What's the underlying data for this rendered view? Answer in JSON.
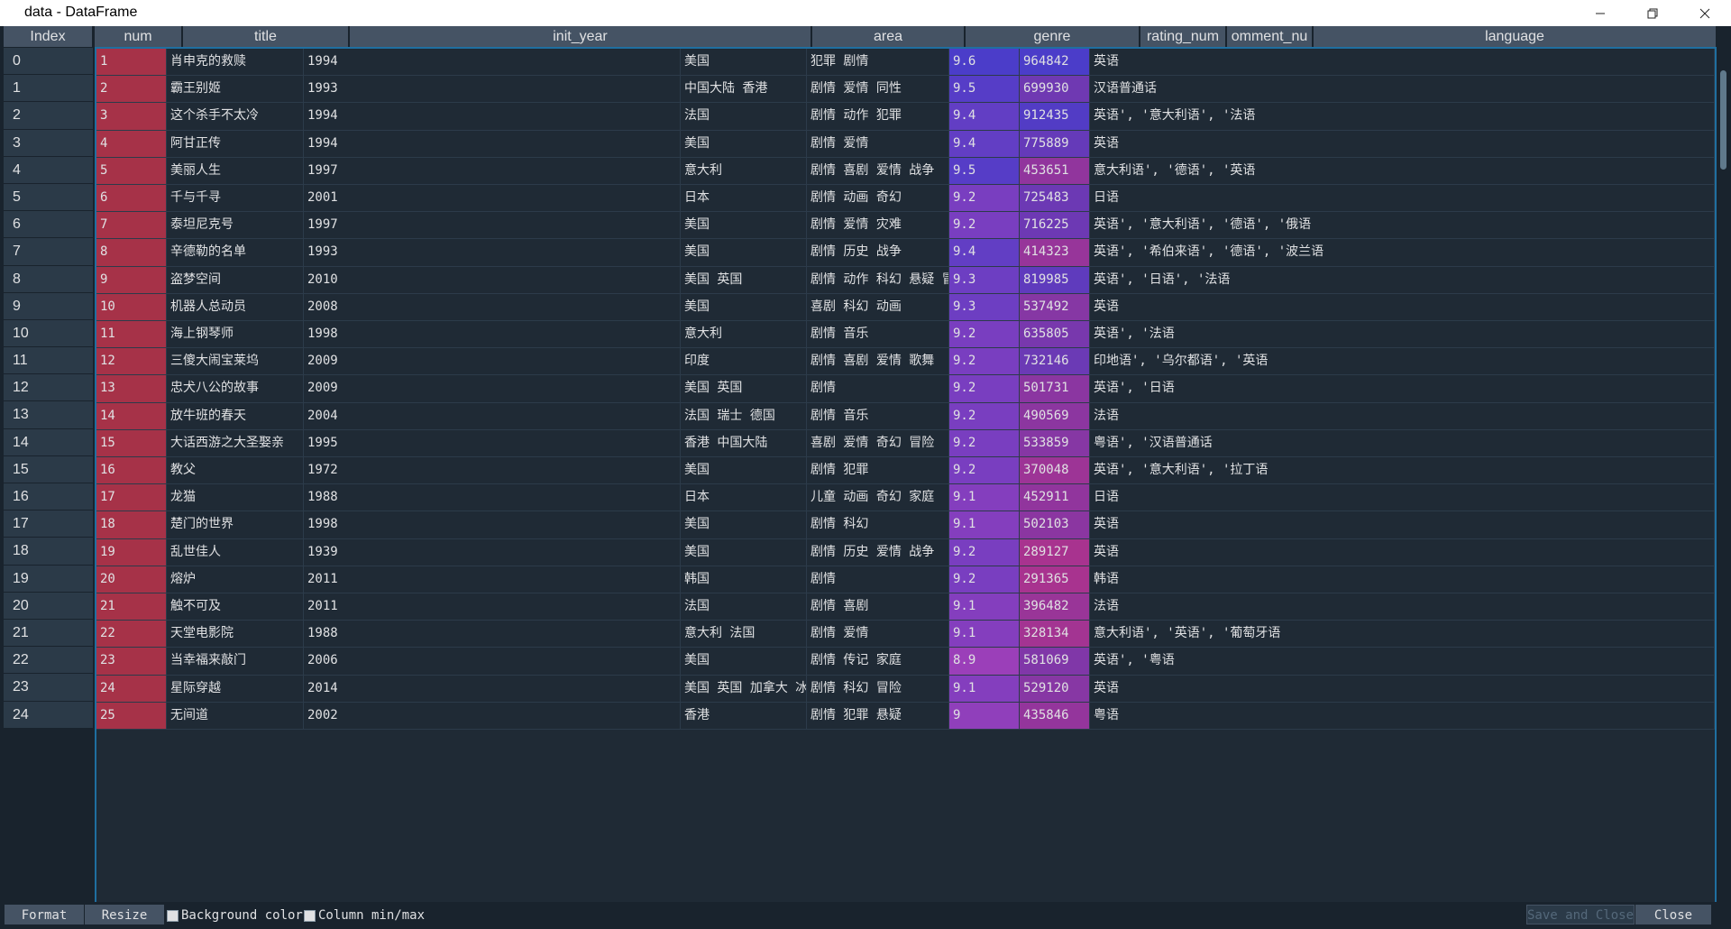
{
  "window": {
    "title": "data - DataFrame"
  },
  "columns": [
    "Index",
    "num",
    "title",
    "init_year",
    "area",
    "genre",
    "rating_num",
    "omment_nu",
    "language"
  ],
  "rows": [
    {
      "index": "0",
      "num": "1",
      "title": "肖申克的救赎",
      "year": "1994",
      "area": "美国",
      "genre": "犯罪 剧情",
      "rating": "9.6",
      "comment": "964842",
      "language": "英语"
    },
    {
      "index": "1",
      "num": "2",
      "title": "霸王别姬",
      "year": "1993",
      "area": "中国大陆 香港",
      "genre": "剧情 爱情 同性",
      "rating": "9.5",
      "comment": "699930",
      "language": "汉语普通话"
    },
    {
      "index": "2",
      "num": "3",
      "title": "这个杀手不太冷",
      "year": "1994",
      "area": "法国",
      "genre": "剧情 动作 犯罪",
      "rating": "9.4",
      "comment": "912435",
      "language": "英语', '意大利语', '法语"
    },
    {
      "index": "3",
      "num": "4",
      "title": "阿甘正传",
      "year": "1994",
      "area": "美国",
      "genre": "剧情 爱情",
      "rating": "9.4",
      "comment": "775889",
      "language": "英语"
    },
    {
      "index": "4",
      "num": "5",
      "title": "美丽人生",
      "year": "1997",
      "area": "意大利",
      "genre": "剧情 喜剧 爱情 战争",
      "rating": "9.5",
      "comment": "453651",
      "language": "意大利语', '德语', '英语"
    },
    {
      "index": "5",
      "num": "6",
      "title": "千与千寻",
      "year": "2001",
      "area": "日本",
      "genre": "剧情 动画 奇幻",
      "rating": "9.2",
      "comment": "725483",
      "language": "日语"
    },
    {
      "index": "6",
      "num": "7",
      "title": "泰坦尼克号",
      "year": "1997",
      "area": "美国",
      "genre": "剧情 爱情 灾难",
      "rating": "9.2",
      "comment": "716225",
      "language": "英语', '意大利语', '德语', '俄语"
    },
    {
      "index": "7",
      "num": "8",
      "title": "辛德勒的名单",
      "year": "1993",
      "area": "美国",
      "genre": "剧情 历史 战争",
      "rating": "9.4",
      "comment": "414323",
      "language": "英语', '希伯来语', '德语', '波兰语"
    },
    {
      "index": "8",
      "num": "9",
      "title": "盗梦空间",
      "year": "2010",
      "area": "美国 英国",
      "genre": "剧情 动作 科幻 悬疑 冒险",
      "rating": "9.3",
      "comment": "819985",
      "language": "英语', '日语', '法语"
    },
    {
      "index": "9",
      "num": "10",
      "title": "机器人总动员",
      "year": "2008",
      "area": "美国",
      "genre": "喜剧 科幻 动画",
      "rating": "9.3",
      "comment": "537492",
      "language": "英语"
    },
    {
      "index": "10",
      "num": "11",
      "title": "海上钢琴师",
      "year": "1998",
      "area": "意大利",
      "genre": "剧情 音乐",
      "rating": "9.2",
      "comment": "635805",
      "language": "英语', '法语"
    },
    {
      "index": "11",
      "num": "12",
      "title": "三傻大闹宝莱坞",
      "year": "2009",
      "area": "印度",
      "genre": "剧情 喜剧 爱情 歌舞",
      "rating": "9.2",
      "comment": "732146",
      "language": "印地语', '乌尔都语', '英语"
    },
    {
      "index": "12",
      "num": "13",
      "title": "忠犬八公的故事",
      "year": "2009",
      "area": "美国 英国",
      "genre": "剧情",
      "rating": "9.2",
      "comment": "501731",
      "language": "英语', '日语"
    },
    {
      "index": "13",
      "num": "14",
      "title": "放牛班的春天",
      "year": "2004",
      "area": "法国 瑞士 德国",
      "genre": "剧情 音乐",
      "rating": "9.2",
      "comment": "490569",
      "language": "法语"
    },
    {
      "index": "14",
      "num": "15",
      "title": "大话西游之大圣娶亲",
      "year": "1995",
      "area": "香港 中国大陆",
      "genre": "喜剧 爱情 奇幻 冒险",
      "rating": "9.2",
      "comment": "533859",
      "language": "粤语', '汉语普通话"
    },
    {
      "index": "15",
      "num": "16",
      "title": "教父",
      "year": "1972",
      "area": "美国",
      "genre": "剧情 犯罪",
      "rating": "9.2",
      "comment": "370048",
      "language": "英语', '意大利语', '拉丁语"
    },
    {
      "index": "16",
      "num": "17",
      "title": "龙猫",
      "year": "1988",
      "area": "日本",
      "genre": "儿童 动画 奇幻 家庭",
      "rating": "9.1",
      "comment": "452911",
      "language": "日语"
    },
    {
      "index": "17",
      "num": "18",
      "title": "楚门的世界",
      "year": "1998",
      "area": "美国",
      "genre": "剧情 科幻",
      "rating": "9.1",
      "comment": "502103",
      "language": "英语"
    },
    {
      "index": "18",
      "num": "19",
      "title": "乱世佳人",
      "year": "1939",
      "area": "美国",
      "genre": "剧情 历史 爱情 战争",
      "rating": "9.2",
      "comment": "289127",
      "language": "英语"
    },
    {
      "index": "19",
      "num": "20",
      "title": "熔炉",
      "year": "2011",
      "area": "韩国",
      "genre": "剧情",
      "rating": "9.2",
      "comment": "291365",
      "language": "韩语"
    },
    {
      "index": "20",
      "num": "21",
      "title": "触不可及",
      "year": "2011",
      "area": "法国",
      "genre": "剧情 喜剧",
      "rating": "9.1",
      "comment": "396482",
      "language": "法语"
    },
    {
      "index": "21",
      "num": "22",
      "title": "天堂电影院",
      "year": "1988",
      "area": "意大利 法国",
      "genre": "剧情 爱情",
      "rating": "9.1",
      "comment": "328134",
      "language": "意大利语', '英语', '葡萄牙语"
    },
    {
      "index": "22",
      "num": "23",
      "title": "当幸福来敲门",
      "year": "2006",
      "area": "美国",
      "genre": "剧情 传记 家庭",
      "rating": "8.9",
      "comment": "581069",
      "language": "英语', '粤语"
    },
    {
      "index": "23",
      "num": "24",
      "title": "星际穿越",
      "year": "2014",
      "area": "美国 英国 加拿大 冰岛",
      "genre": "剧情 科幻 冒险",
      "rating": "9.1",
      "comment": "529120",
      "language": "英语"
    },
    {
      "index": "24",
      "num": "25",
      "title": "无间道",
      "year": "2002",
      "area": "香港",
      "genre": "剧情 犯罪 悬疑",
      "rating": "9",
      "comment": "435846",
      "language": "粤语"
    }
  ],
  "colors": {
    "num_bg": "#a63248",
    "rating_hi": "#4b3dc9",
    "rating_lo": "#9b3fb9",
    "comment_hi": "#4b3dc9",
    "comment_lo": "#a8338f"
  },
  "bottom": {
    "format": "Format",
    "resize": "Resize",
    "bg_color": "Background color",
    "col_minmax": "Column min/max",
    "save_close": "Save and Close",
    "close": "Close"
  }
}
